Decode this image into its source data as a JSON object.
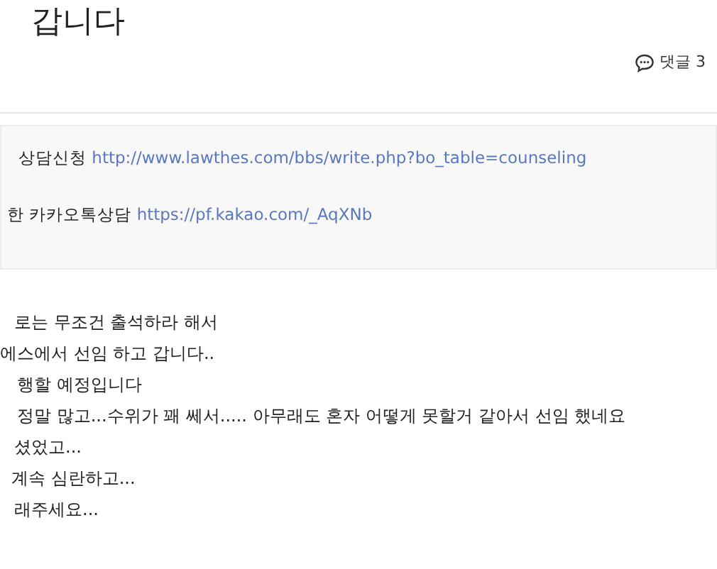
{
  "title": "갑니다",
  "comments": {
    "label": "댓글",
    "count": "3"
  },
  "notice": [
    {
      "label": "상담신청",
      "link": "http://www.lawthes.com/bbs/write.php?bo_table=counseling"
    },
    {
      "label": "한 카카오톡상담",
      "link": "https://pf.kakao.com/_AqXNb"
    }
  ],
  "body": [
    "로는 무조건 출석하라 해서",
    "에스에서 선임 하고 갑니다..",
    "행할 예정입니다",
    "정말 많고...수위가 꽤 쎄서..... 아무래도 혼자 어떻게 못할거 같아서 선임 했네요",
    "셨었고...",
    "계속 심란하고...",
    "래주세요..."
  ]
}
